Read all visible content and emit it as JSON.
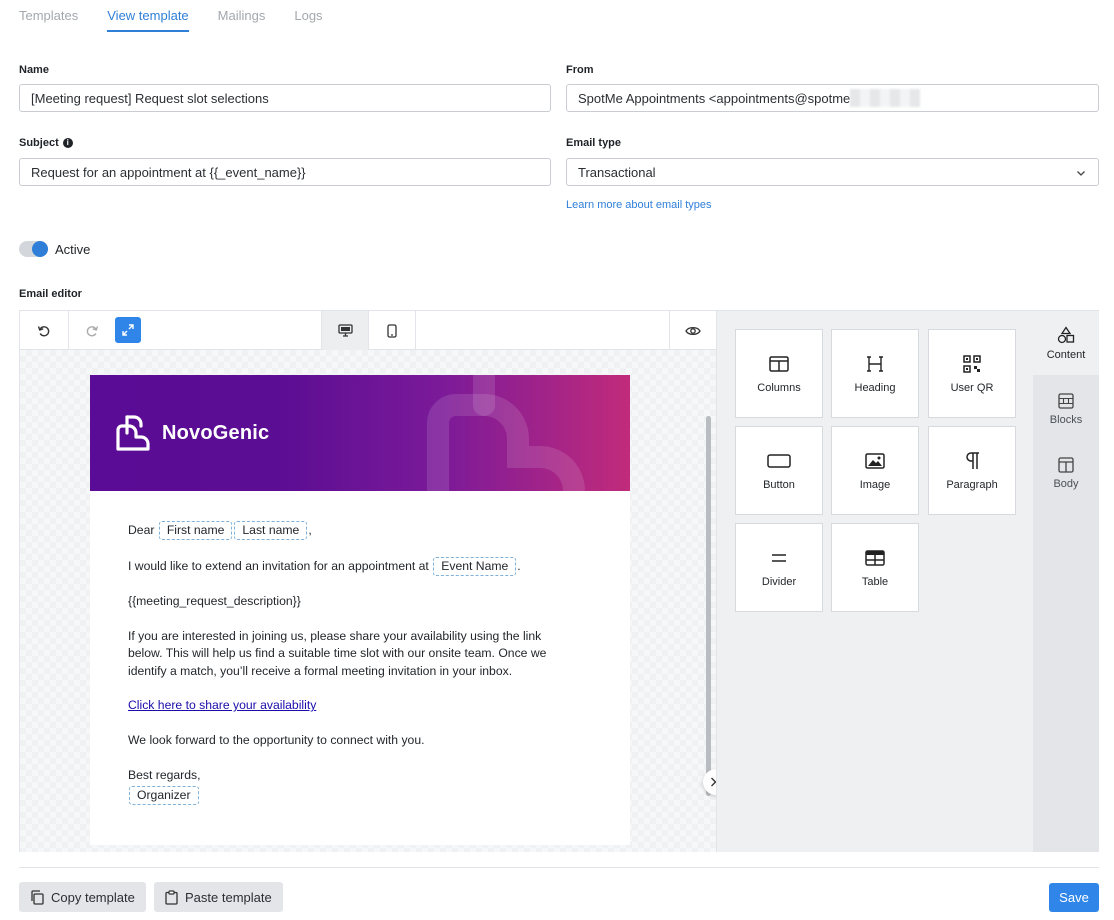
{
  "tabs": [
    {
      "label": "Templates",
      "active": false
    },
    {
      "label": "View template",
      "active": true
    },
    {
      "label": "Mailings",
      "active": false
    },
    {
      "label": "Logs",
      "active": false
    }
  ],
  "form": {
    "name_label": "Name",
    "name_value": "[Meeting request] Request slot selections",
    "from_label": "From",
    "from_value": "SpotMe Appointments <appointments@spotme",
    "subject_label": "Subject",
    "subject_value": "Request for an appointment at {{_event_name}}",
    "email_type_label": "Email type",
    "email_type_value": "Transactional",
    "email_type_link": "Learn more about email types",
    "active_label": "Active",
    "active_on": true
  },
  "editor": {
    "label": "Email editor",
    "brand_name": "NovoGenic",
    "body": {
      "dear": "Dear",
      "first_name_tag": "First name",
      "last_name_tag": "Last name",
      "comma": ",",
      "invite_text": "I would like to extend an invitation for an appointment at",
      "event_name_tag": "Event Name",
      "period": ".",
      "description_var": "{{meeting_request_description}}",
      "paragraph": "If you are interested in joining us, please share your availability using the link below. This will help us find a suitable time slot with our onsite team. Once we identify a match, you’ll receive a formal meeting invitation in your inbox.",
      "link_text": "Click here to share your availability",
      "closing": "We look forward to the opportunity to connect with you.",
      "regards": "Best regards,",
      "organizer_tag": "Organizer"
    },
    "tiles": [
      {
        "label": "Columns",
        "icon": "columns-icon"
      },
      {
        "label": "Heading",
        "icon": "heading-icon"
      },
      {
        "label": "User QR",
        "icon": "qr-code-icon"
      },
      {
        "label": "Button",
        "icon": "button-icon"
      },
      {
        "label": "Image",
        "icon": "image-icon"
      },
      {
        "label": "Paragraph",
        "icon": "paragraph-icon"
      },
      {
        "label": "Divider",
        "icon": "divider-icon"
      },
      {
        "label": "Table",
        "icon": "table-icon"
      }
    ],
    "side_tabs": [
      {
        "label": "Content",
        "icon": "shapes-icon",
        "active": true
      },
      {
        "label": "Blocks",
        "icon": "blocks-icon",
        "active": false
      },
      {
        "label": "Body",
        "icon": "body-layout-icon",
        "active": false
      }
    ]
  },
  "footer": {
    "copy_label": "Copy template",
    "paste_label": "Paste template",
    "save_label": "Save"
  },
  "colors": {
    "accent": "#2f7fd8",
    "save": "#2f86e8",
    "banner_start": "#5a0c96",
    "banner_end": "#c12b7b"
  }
}
